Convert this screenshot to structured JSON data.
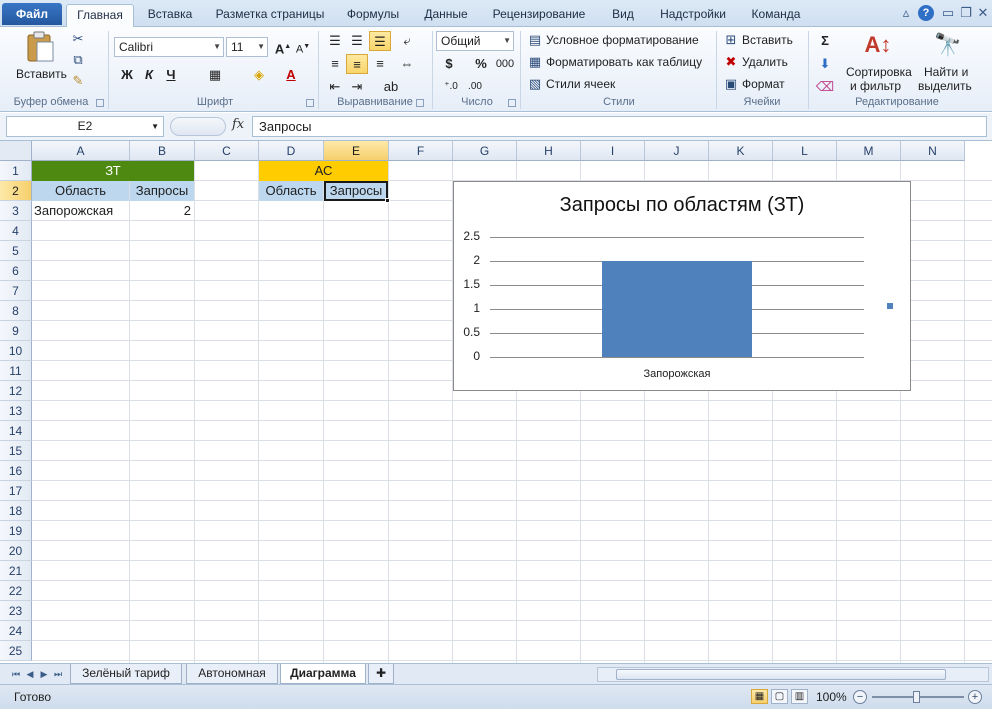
{
  "ribbon_tabs": [
    "Файл",
    "Главная",
    "Вставка",
    "Разметка страницы",
    "Формулы",
    "Данные",
    "Рецензирование",
    "Вид",
    "Надстройки",
    "Команда"
  ],
  "ribbon": {
    "clipboard": {
      "paste_label": "Вставить",
      "group_label": "Буфер обмена"
    },
    "font": {
      "name": "Calibri",
      "size": "11",
      "bold": "Ж",
      "italic": "К",
      "underline": "Ч",
      "group_label": "Шрифт"
    },
    "alignment": {
      "group_label": "Выравнивание"
    },
    "number": {
      "format": "Общий",
      "currency": "$",
      "percent": "%",
      "thousands": "000",
      "group_label": "Число"
    },
    "styles": {
      "conditional": "Условное форматирование",
      "format_table": "Форматировать как таблицу",
      "cell_styles": "Стили ячеек",
      "group_label": "Стили"
    },
    "cells": {
      "insert": "Вставить",
      "delete": "Удалить",
      "format": "Формат",
      "group_label": "Ячейки"
    },
    "editing": {
      "sort_line1": "Сортировка",
      "sort_line2": "и фильтр",
      "find_line1": "Найти и",
      "find_line2": "выделить",
      "group_label": "Редактирование"
    }
  },
  "formula_bar": {
    "name_box": "E2",
    "fx": "fx",
    "content": "Запросы"
  },
  "columns": [
    "A",
    "B",
    "C",
    "D",
    "E",
    "F",
    "G",
    "H",
    "I",
    "J",
    "K",
    "L",
    "M",
    "N"
  ],
  "rows": [
    "1",
    "2",
    "3",
    "4",
    "5",
    "6",
    "7",
    "8",
    "9",
    "10",
    "11",
    "12",
    "13",
    "14",
    "15",
    "16",
    "17",
    "18",
    "19",
    "20",
    "21",
    "22",
    "23",
    "24",
    "25"
  ],
  "cells": {
    "A1_B1": "ЗТ",
    "A2": "Область",
    "B2": "Запросы",
    "A3": "Запорожская",
    "B3": "2",
    "D1_E1": "АС",
    "D2": "Область",
    "E2": "Запросы"
  },
  "colors": {
    "zt_header": "#4e8a12",
    "ac_header": "#ffcc00",
    "sub_header": "#bdd7ee",
    "bar": "#4f81bd"
  },
  "chart_data": {
    "type": "bar",
    "title": "Запросы по областям (ЗТ)",
    "categories": [
      "Запорожская"
    ],
    "values": [
      2
    ],
    "ylim": [
      0,
      2.5
    ],
    "yticks": [
      "2.5",
      "2",
      "1.5",
      "1",
      "0.5",
      "0"
    ],
    "grid": true,
    "legend": "right"
  },
  "sheet_tabs": [
    "Зелёный тариф",
    "Автономная",
    "Диаграмма"
  ],
  "active_sheet": "Диаграмма",
  "status": {
    "ready": "Готово",
    "zoom": "100%"
  }
}
